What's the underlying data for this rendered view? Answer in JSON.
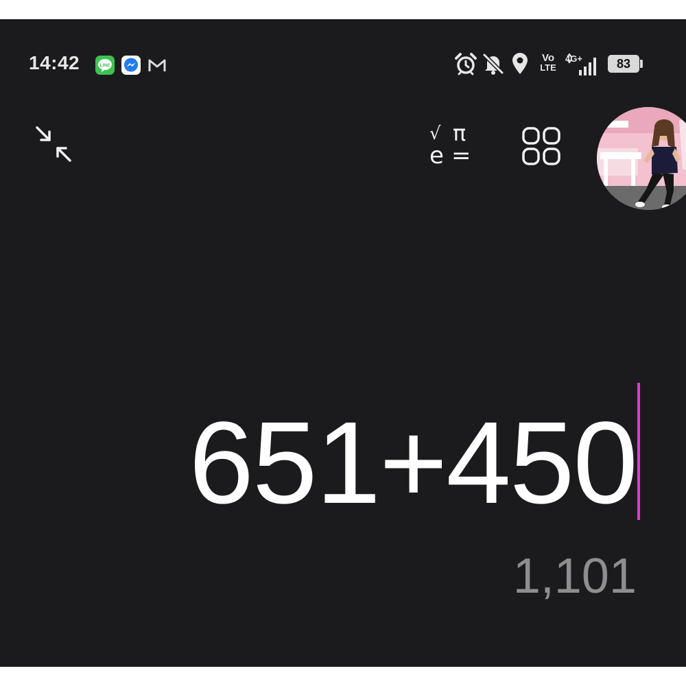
{
  "status_bar": {
    "time": "14:42",
    "notifications": [
      "line-icon",
      "messenger-icon",
      "gmail-icon"
    ],
    "notification_line_label": "LINE",
    "volte_top": "Vo",
    "volte_bottom": "LTE",
    "network": "4G+",
    "battery": "83"
  },
  "toolbar": {
    "collapse_icon": "collapse-arrows-icon",
    "scientific_icon": "scientific-mode-icon",
    "apps_icon": "grid-apps-icon",
    "sym_sqrt": "√",
    "sym_pi": "π",
    "sym_e": "e",
    "sym_eq": "="
  },
  "calculator": {
    "expression": "651+450",
    "result": "1,101"
  },
  "colors": {
    "background": "#1b1b1d",
    "cursor": "#e03ad6",
    "result_text": "#8e8e8e"
  }
}
